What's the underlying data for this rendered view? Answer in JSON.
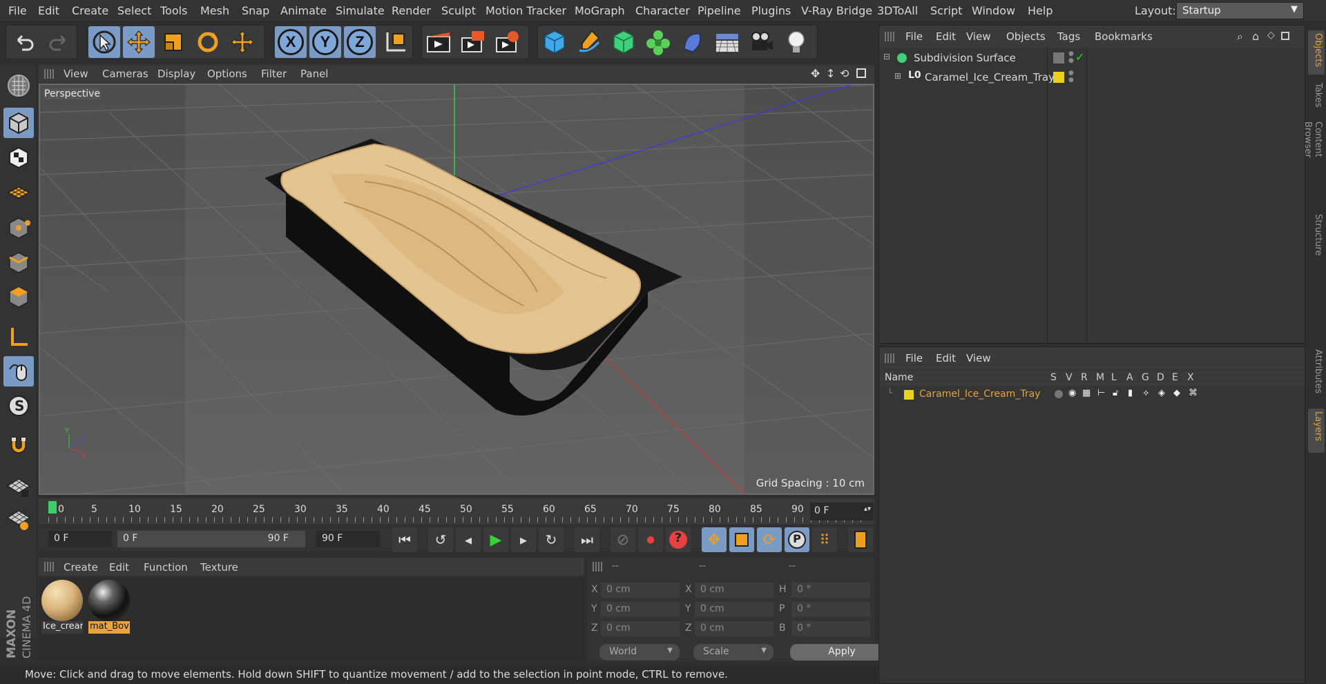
{
  "menubar": {
    "items": [
      "File",
      "Edit",
      "Create",
      "Select",
      "Tools",
      "Mesh",
      "Snap",
      "Animate",
      "Simulate",
      "Render",
      "Sculpt",
      "Motion Tracker",
      "MoGraph",
      "Character",
      "Pipeline",
      "Plugins",
      "V-Ray Bridge",
      "3DToAll",
      "Script",
      "Window",
      "Help"
    ],
    "layout_label": "Layout:",
    "layout_value": "Startup"
  },
  "viewport": {
    "menu": [
      "View",
      "Cameras",
      "Display",
      "Options",
      "Filter",
      "Panel"
    ],
    "camera_label": "Perspective",
    "grid_spacing": "Grid Spacing : 10 cm"
  },
  "timeline": {
    "ticks": [
      "0",
      "5",
      "10",
      "15",
      "20",
      "25",
      "30",
      "35",
      "40",
      "45",
      "50",
      "55",
      "60",
      "65",
      "70",
      "75",
      "80",
      "85",
      "90"
    ],
    "current_frame": "0 F"
  },
  "transport": {
    "start": "0 F",
    "range_start": "0 F",
    "range_end": "90 F",
    "end": "90 F"
  },
  "materials": {
    "menu": [
      "Create",
      "Edit",
      "Function",
      "Texture"
    ],
    "items": [
      {
        "name": "Ice_crear",
        "selected": false
      },
      {
        "name": "mat_Bov",
        "selected": true
      }
    ]
  },
  "coordinates": {
    "headers": [
      "--",
      "--",
      "--"
    ],
    "rows": [
      {
        "a": "X",
        "av": "0 cm",
        "b": "X",
        "bv": "0 cm",
        "c": "H",
        "cv": "0 °"
      },
      {
        "a": "Y",
        "av": "0 cm",
        "b": "Y",
        "bv": "0 cm",
        "c": "P",
        "cv": "0 °"
      },
      {
        "a": "Z",
        "av": "0 cm",
        "b": "Z",
        "bv": "0 cm",
        "c": "B",
        "cv": "0 °"
      }
    ],
    "world": "World",
    "scale": "Scale",
    "apply": "Apply"
  },
  "status": "Move: Click and drag to move elements. Hold down SHIFT to quantize movement / add to the selection in point mode, CTRL to remove.",
  "objects": {
    "menu": [
      "File",
      "Edit",
      "View",
      "Objects",
      "Tags",
      "Bookmarks"
    ],
    "tree": [
      {
        "name": "Subdivision Surface"
      },
      {
        "name": "Caramel_Ice_Cream_Tray"
      }
    ]
  },
  "layers": {
    "menu": [
      "File",
      "Edit",
      "View"
    ],
    "header_name": "Name",
    "header_flags": [
      "S",
      "V",
      "R",
      "M",
      "L",
      "A",
      "G",
      "D",
      "E",
      "X"
    ],
    "rows": [
      {
        "name": "Caramel_Ice_Cream_Tray"
      }
    ]
  },
  "right_tabs": [
    "Objects",
    "Takes",
    "Content Browser",
    "Structure",
    "Attributes",
    "Layers"
  ],
  "brand": {
    "line1": "MAXON",
    "line2": "CINEMA 4D"
  },
  "colors": {
    "accent": "#e8a33a",
    "selected_tool": "#7a9bc6",
    "layer_color": "#e8d21f"
  }
}
